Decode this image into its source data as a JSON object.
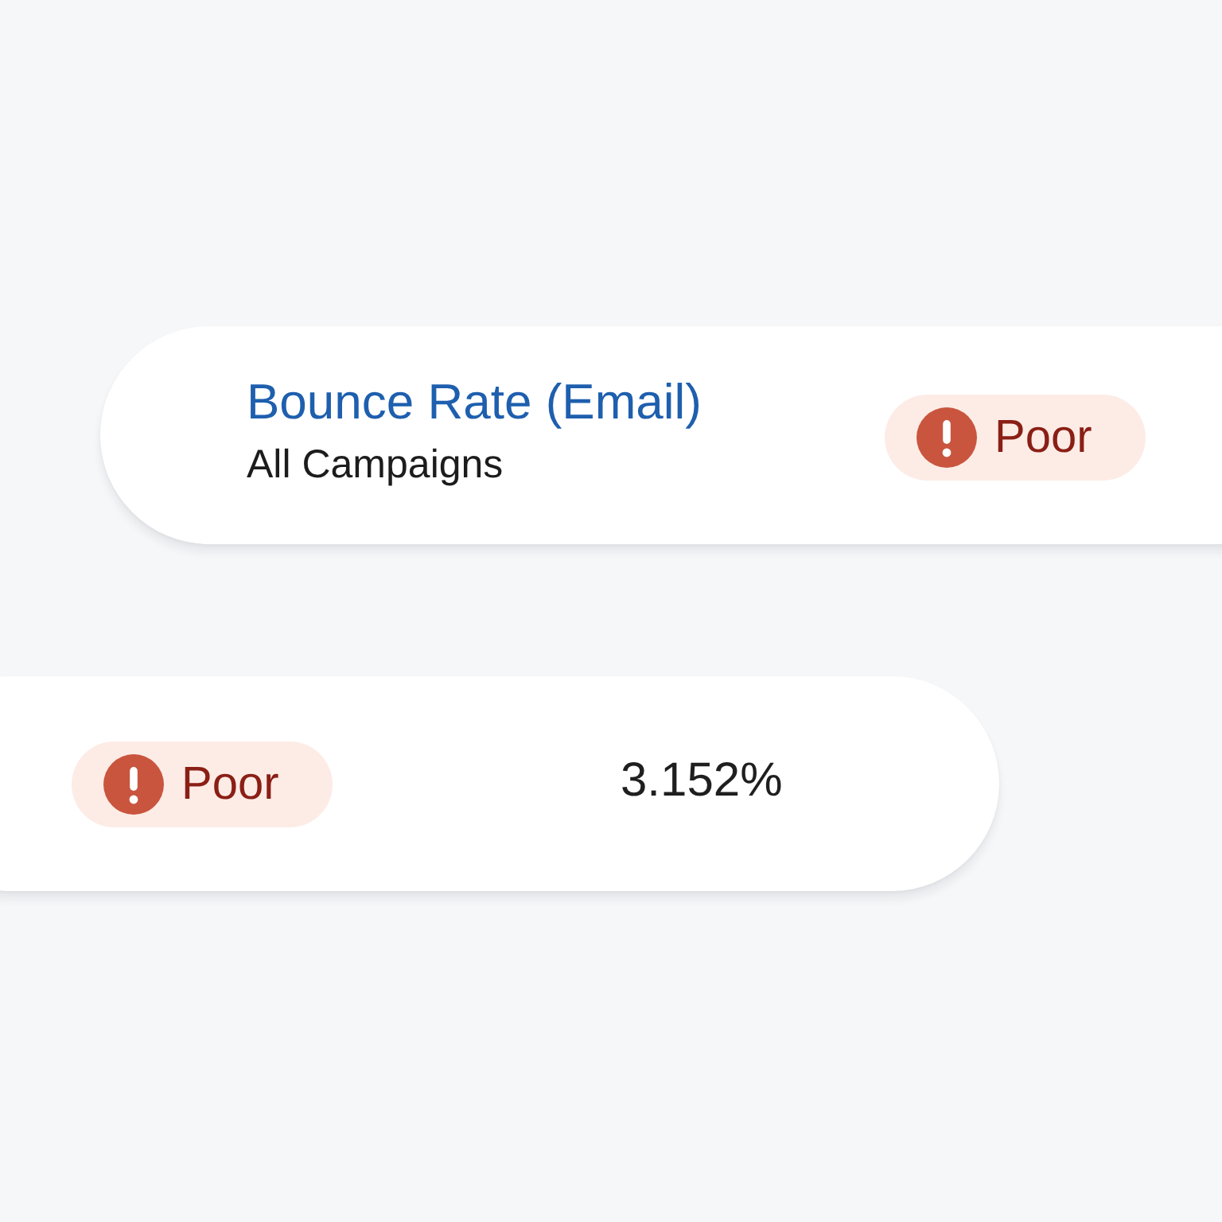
{
  "cards": [
    {
      "kind": "heading",
      "title": "Bounce Rate (Email)",
      "subtitle": "All Campaigns",
      "status": {
        "kind": "poor",
        "label": "Poor"
      }
    },
    {
      "kind": "value",
      "status": {
        "kind": "poor",
        "label": "Poor"
      },
      "value": "3.152%"
    }
  ]
}
